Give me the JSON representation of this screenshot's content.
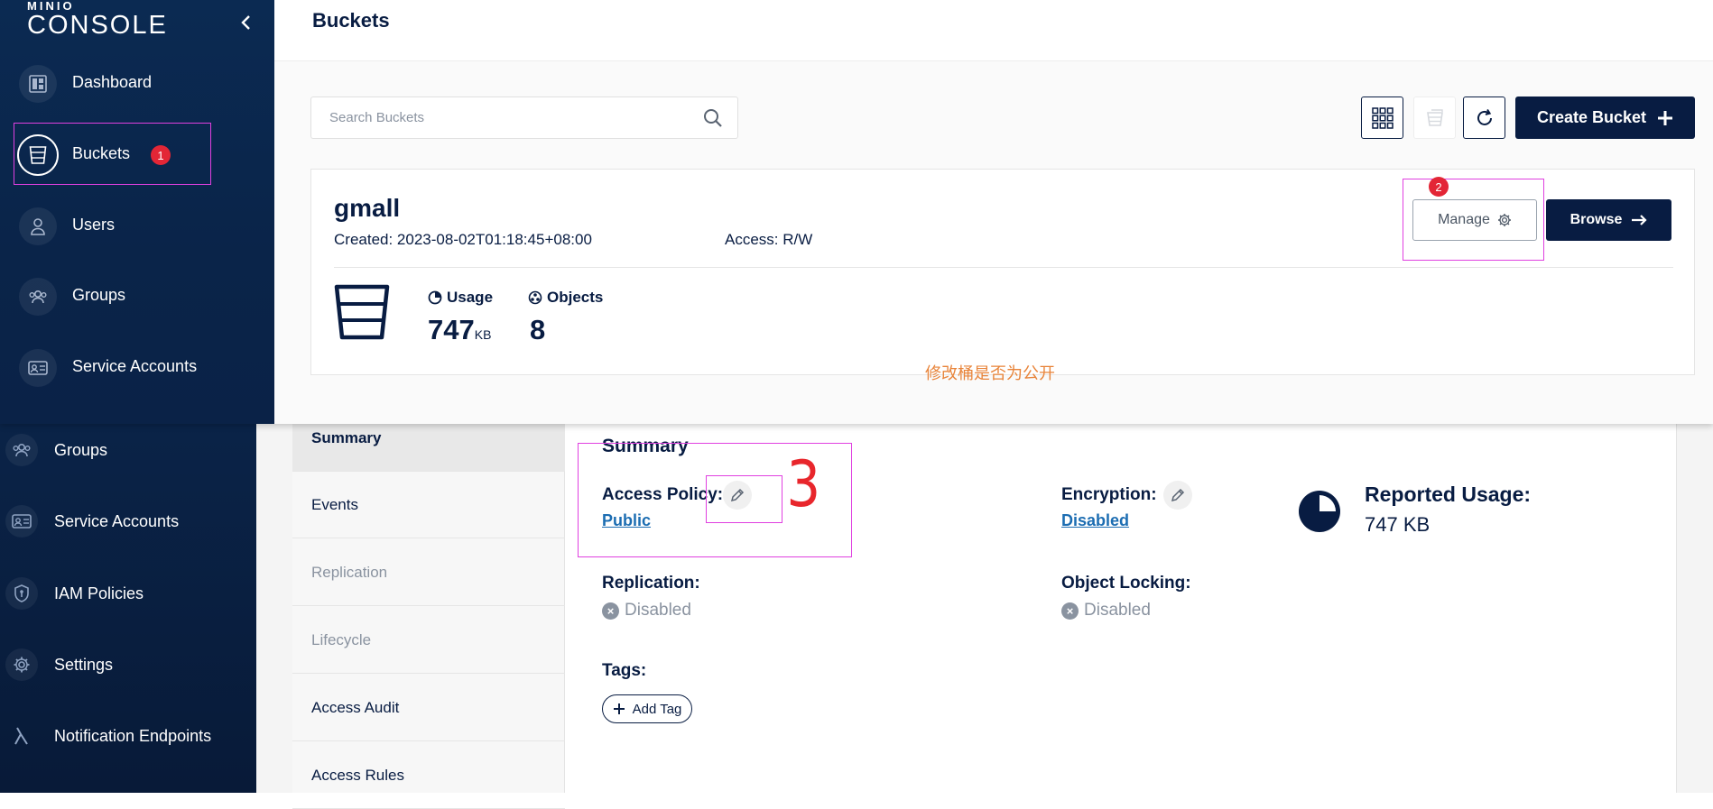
{
  "top_screen": {
    "logo": {
      "small": "MINIO",
      "big": "CONSOLE"
    },
    "sidebar": {
      "items": [
        {
          "label": "Dashboard",
          "icon": "dashboard-icon"
        },
        {
          "label": "Buckets",
          "icon": "bucket-icon",
          "badge": "1",
          "active": true
        },
        {
          "label": "Users",
          "icon": "user-icon"
        },
        {
          "label": "Groups",
          "icon": "groups-icon"
        },
        {
          "label": "Service Accounts",
          "icon": "id-card-icon"
        }
      ]
    },
    "page_title": "Buckets",
    "search": {
      "placeholder": "Search Buckets",
      "value": ""
    },
    "create_label": "Create Bucket",
    "bucket": {
      "name": "gmall",
      "created": "Created: 2023-08-02T01:18:45+08:00",
      "access": "Access: R/W",
      "usage_label": "Usage",
      "usage_value": "747",
      "usage_unit": "KB",
      "objects_label": "Objects",
      "objects_value": "8",
      "manage_label": "Manage",
      "manage_badge": "2",
      "browse_label": "Browse"
    },
    "note": "修改桶是否为公开"
  },
  "bottom_screen": {
    "sidebar": {
      "items": [
        {
          "label": "Groups",
          "icon": "groups-icon"
        },
        {
          "label": "Service Accounts",
          "icon": "id-card-icon"
        },
        {
          "label": "IAM Policies",
          "icon": "shield-icon"
        },
        {
          "label": "Settings",
          "icon": "gear-icon"
        },
        {
          "label": "Notification Endpoints",
          "icon": "lambda-icon"
        }
      ]
    },
    "tabs": [
      {
        "label": "Summary",
        "active": true
      },
      {
        "label": "Events"
      },
      {
        "label": "Replication",
        "disabled": true
      },
      {
        "label": "Lifecycle",
        "disabled": true
      },
      {
        "label": "Access Audit"
      },
      {
        "label": "Access Rules"
      }
    ],
    "summary": {
      "title": "Summary",
      "access_policy_label": "Access Policy:",
      "access_policy_value": "Public",
      "encryption_label": "Encryption:",
      "encryption_value": "Disabled",
      "reported_usage_label": "Reported Usage:",
      "reported_usage_value": "747 KB",
      "replication_label": "Replication:",
      "replication_value": "Disabled",
      "object_locking_label": "Object Locking:",
      "object_locking_value": "Disabled",
      "tags_label": "Tags:",
      "add_tag_label": "Add Tag"
    }
  },
  "annotations": {
    "step3": "3"
  },
  "colors": {
    "navy": "#081c42",
    "annotation": "#e040e0",
    "badge": "#e32636",
    "link": "#1c6db2",
    "note": "#e8843a"
  }
}
